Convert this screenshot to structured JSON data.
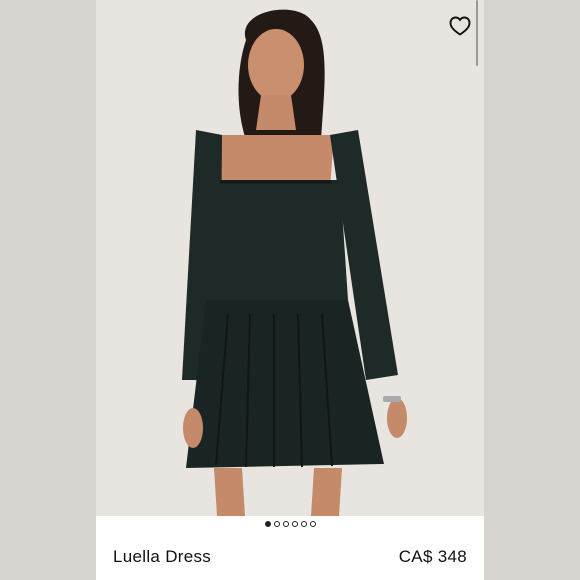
{
  "product": {
    "name": "Luella Dress",
    "price": "CA$ 348"
  },
  "gallery": {
    "slide_count": 6,
    "active_index": 0
  },
  "icons": {
    "wishlist": "heart-outline-icon"
  },
  "colors": {
    "dress": "#1d2a27",
    "background": "#e7e3de",
    "text": "#111111"
  }
}
